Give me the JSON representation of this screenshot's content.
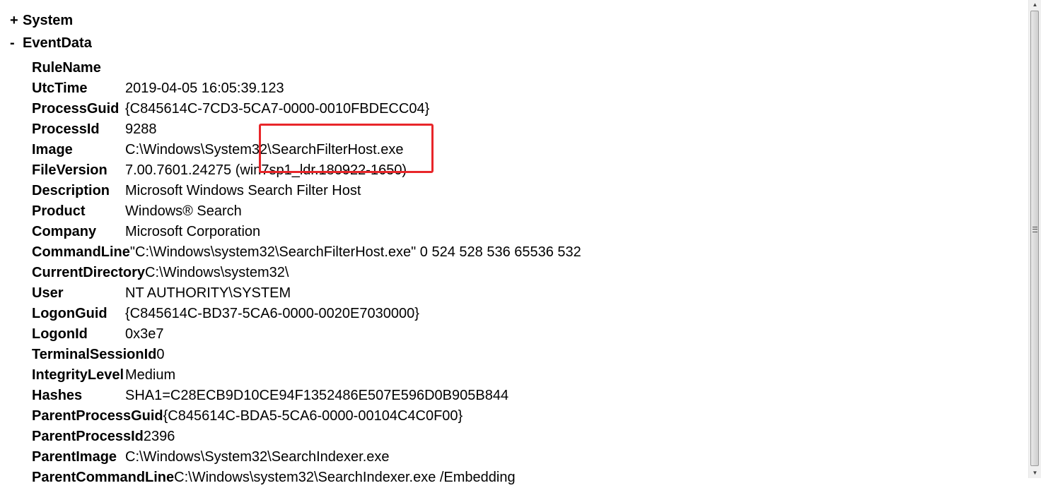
{
  "tree": {
    "system": {
      "sign": "+",
      "label": "System"
    },
    "eventdata": {
      "sign": "-",
      "label": "EventData"
    }
  },
  "rows": [
    {
      "label": "RuleName",
      "value": ""
    },
    {
      "label": "UtcTime",
      "value": "2019-04-05 16:05:39.123"
    },
    {
      "label": "ProcessGuid",
      "value": "{C845614C-7CD3-5CA7-0000-0010FBDECC04}"
    },
    {
      "label": "ProcessId",
      "value": "9288"
    },
    {
      "label": "Image",
      "value": "C:\\Windows\\System32\\SearchFilterHost.exe"
    },
    {
      "label": "FileVersion",
      "value": "7.00.7601.24275 (win7sp1_ldr.180922-1650)"
    },
    {
      "label": "Description",
      "value": "Microsoft Windows Search Filter Host"
    },
    {
      "label": "Product",
      "value": "Windows® Search"
    },
    {
      "label": "Company",
      "value": "Microsoft Corporation"
    },
    {
      "label": "CommandLine",
      "value": "\"C:\\Windows\\system32\\SearchFilterHost.exe\" 0 524 528 536 65536 532"
    },
    {
      "label": "CurrentDirectory",
      "value": "C:\\Windows\\system32\\"
    },
    {
      "label": "User",
      "value": "NT AUTHORITY\\SYSTEM"
    },
    {
      "label": "LogonGuid",
      "value": "{C845614C-BD37-5CA6-0000-0020E7030000}"
    },
    {
      "label": "LogonId",
      "value": "0x3e7"
    },
    {
      "label": "TerminalSessionId",
      "value": "0"
    },
    {
      "label": "IntegrityLevel",
      "value": "Medium"
    },
    {
      "label": "Hashes",
      "value": "SHA1=C28ECB9D10CE94F1352486E507E596D0B905B844"
    },
    {
      "label": "ParentProcessGuid",
      "value": "{C845614C-BDA5-5CA6-0000-00104C4C0F00}"
    },
    {
      "label": "ParentProcessId",
      "value": "2396"
    },
    {
      "label": "ParentImage",
      "value": "C:\\Windows\\System32\\SearchIndexer.exe"
    },
    {
      "label": "ParentCommandLine",
      "value": "C:\\Windows\\system32\\SearchIndexer.exe /Embedding"
    }
  ],
  "colors": {
    "highlight": "#e8262a"
  },
  "scrollbar": {
    "up_icon": "▲",
    "down_icon": "▼"
  }
}
